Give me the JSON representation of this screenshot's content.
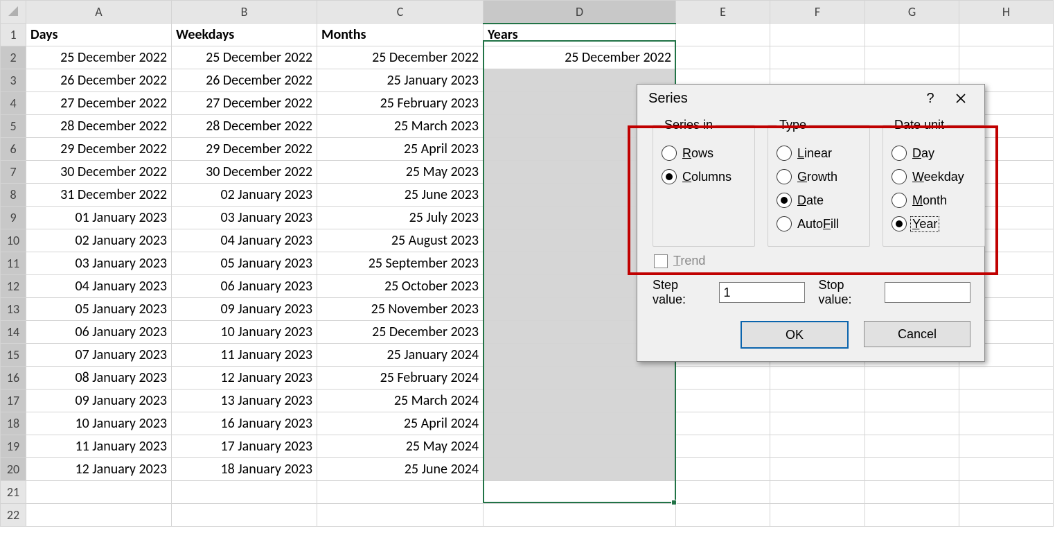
{
  "columns": [
    "A",
    "B",
    "C",
    "D",
    "E",
    "F",
    "G",
    "H"
  ],
  "headers": {
    "A": "Days",
    "B": "Weekdays",
    "C": "Months",
    "D": "Years"
  },
  "rows": [
    {
      "n": 1,
      "A": "Days",
      "B": "Weekdays",
      "C": "Months",
      "D": "Years"
    },
    {
      "n": 2,
      "A": "25 December 2022",
      "B": "25 December 2022",
      "C": "25 December 2022",
      "D": "25 December 2022"
    },
    {
      "n": 3,
      "A": "26 December 2022",
      "B": "26 December 2022",
      "C": "25 January 2023",
      "D": ""
    },
    {
      "n": 4,
      "A": "27 December 2022",
      "B": "27 December 2022",
      "C": "25 February 2023",
      "D": ""
    },
    {
      "n": 5,
      "A": "28 December 2022",
      "B": "28 December 2022",
      "C": "25 March 2023",
      "D": ""
    },
    {
      "n": 6,
      "A": "29 December 2022",
      "B": "29 December 2022",
      "C": "25 April 2023",
      "D": ""
    },
    {
      "n": 7,
      "A": "30 December 2022",
      "B": "30 December 2022",
      "C": "25 May 2023",
      "D": ""
    },
    {
      "n": 8,
      "A": "31 December 2022",
      "B": "02 January 2023",
      "C": "25 June 2023",
      "D": ""
    },
    {
      "n": 9,
      "A": "01 January 2023",
      "B": "03 January 2023",
      "C": "25 July 2023",
      "D": ""
    },
    {
      "n": 10,
      "A": "02 January 2023",
      "B": "04 January 2023",
      "C": "25 August 2023",
      "D": ""
    },
    {
      "n": 11,
      "A": "03 January 2023",
      "B": "05 January 2023",
      "C": "25 September 2023",
      "D": ""
    },
    {
      "n": 12,
      "A": "04 January 2023",
      "B": "06 January 2023",
      "C": "25 October 2023",
      "D": ""
    },
    {
      "n": 13,
      "A": "05 January 2023",
      "B": "09 January 2023",
      "C": "25 November 2023",
      "D": ""
    },
    {
      "n": 14,
      "A": "06 January 2023",
      "B": "10 January 2023",
      "C": "25 December 2023",
      "D": ""
    },
    {
      "n": 15,
      "A": "07 January 2023",
      "B": "11 January 2023",
      "C": "25 January 2024",
      "D": ""
    },
    {
      "n": 16,
      "A": "08 January 2023",
      "B": "12 January 2023",
      "C": "25 February 2024",
      "D": ""
    },
    {
      "n": 17,
      "A": "09 January 2023",
      "B": "13 January 2023",
      "C": "25 March 2024",
      "D": ""
    },
    {
      "n": 18,
      "A": "10 January 2023",
      "B": "16 January 2023",
      "C": "25 April 2024",
      "D": ""
    },
    {
      "n": 19,
      "A": "11 January 2023",
      "B": "17 January 2023",
      "C": "25 May 2024",
      "D": ""
    },
    {
      "n": 20,
      "A": "12 January 2023",
      "B": "18 January 2023",
      "C": "25 June 2024",
      "D": ""
    },
    {
      "n": 21,
      "A": "",
      "B": "",
      "C": "",
      "D": ""
    },
    {
      "n": 22,
      "A": "",
      "B": "",
      "C": "",
      "D": ""
    }
  ],
  "dialog": {
    "title": "Series",
    "help": "?",
    "groups": {
      "series_in": {
        "legend": "Series in",
        "rows": "Rows",
        "columns": "Columns",
        "selected": "columns"
      },
      "type": {
        "legend": "Type",
        "linear": "Linear",
        "growth": "Growth",
        "date": "Date",
        "autofill": "AutoFill",
        "selected": "date"
      },
      "date_unit": {
        "legend": "Date unit",
        "day": "Day",
        "weekday": "Weekday",
        "month": "Month",
        "year": "Year",
        "selected": "year"
      }
    },
    "trend": "Trend",
    "step_label": "Step value:",
    "step_value": "1",
    "stop_label": "Stop value:",
    "stop_value": "",
    "ok": "OK",
    "cancel": "Cancel"
  },
  "underline": {
    "Rows": "R",
    "Columns": "C",
    "Linear": "L",
    "Growth": "G",
    "Date": "D",
    "AutoFill": "F",
    "Day": "D",
    "Weekday": "W",
    "Month": "M",
    "Year": "Y",
    "Trend": "T",
    "Step value:": "S",
    "Stop value:": "o"
  }
}
